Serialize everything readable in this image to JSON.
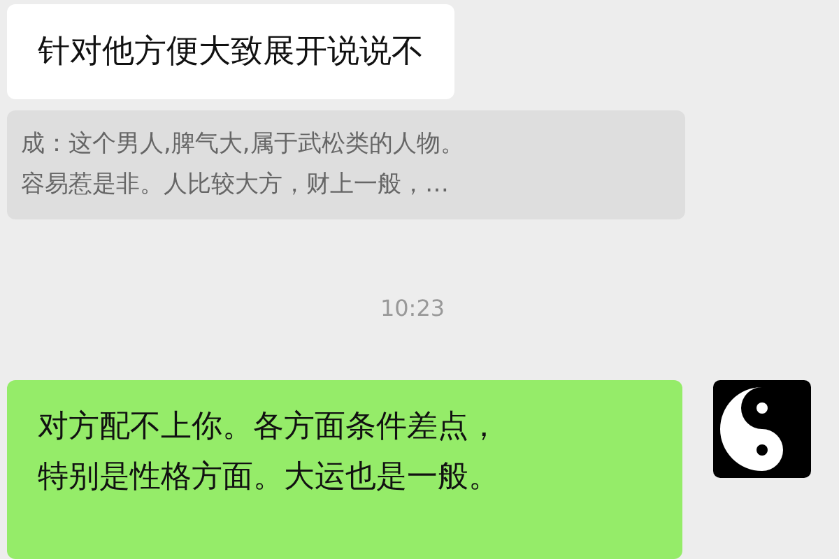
{
  "received_message": {
    "text": "针对他方便大致展开说说不"
  },
  "quoted_reply": {
    "lines": [
      "成：这个男人,脾气大,属于武松类的人物。",
      "容易惹是非。人比较大方，财上一般，…"
    ]
  },
  "timestamp": "10:23",
  "sent_message": {
    "lines": [
      "对方配不上你。各方面条件差点，",
      "特别是性格方面。大运也是一般。"
    ]
  }
}
